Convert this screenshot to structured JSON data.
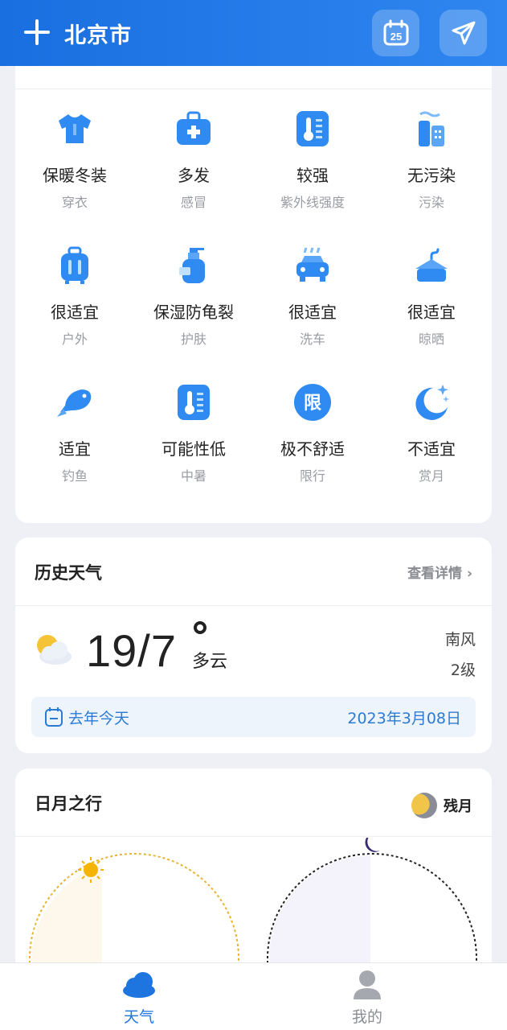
{
  "header": {
    "city": "北京市"
  },
  "life": {
    "items": [
      {
        "value": "保暖冬装",
        "label": "穿衣",
        "icon": "shirt-icon"
      },
      {
        "value": "多发",
        "label": "感冒",
        "icon": "medkit-icon"
      },
      {
        "value": "较强",
        "label": "紫外线强度",
        "icon": "thermometer-icon"
      },
      {
        "value": "无污染",
        "label": "污染",
        "icon": "factory-icon"
      },
      {
        "value": "很适宜",
        "label": "户外",
        "icon": "luggage-icon"
      },
      {
        "value": "保湿防龟裂",
        "label": "护肤",
        "icon": "lotion-icon"
      },
      {
        "value": "很适宜",
        "label": "洗车",
        "icon": "car-icon"
      },
      {
        "value": "很适宜",
        "label": "晾晒",
        "icon": "hanger-icon"
      },
      {
        "value": "适宜",
        "label": "钓鱼",
        "icon": "fish-icon"
      },
      {
        "value": "可能性低",
        "label": "中暑",
        "icon": "thermometer-icon"
      },
      {
        "value": "极不舒适",
        "label": "限行",
        "icon": "limit-icon",
        "icon_text": "限"
      },
      {
        "value": "不适宜",
        "label": "赏月",
        "icon": "moon-icon"
      }
    ]
  },
  "history": {
    "title": "历史天气",
    "more": "查看详情",
    "temp": "19/7",
    "condition": "多云",
    "wind": "南风",
    "wind_level": "2级",
    "bar_label": "去年今天",
    "bar_date": "2023年3月08日"
  },
  "sunmoon": {
    "title": "日月之行",
    "moon_phase": "残月"
  },
  "nav": {
    "weather": "天气",
    "mine": "我的"
  },
  "colors": {
    "accent": "#1f75e0",
    "header": "#1a6fe0"
  }
}
